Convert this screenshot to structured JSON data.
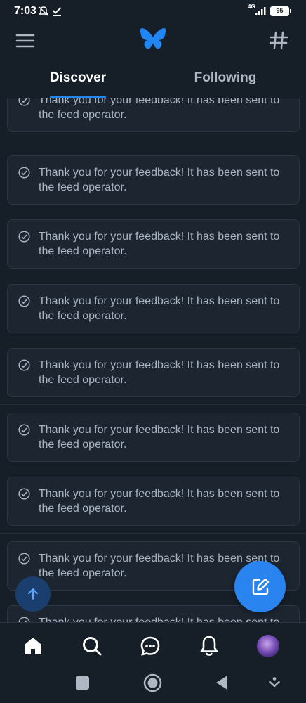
{
  "status_bar": {
    "time": "7:03",
    "network": "4G",
    "battery": "95"
  },
  "header": {
    "tabs": [
      {
        "label": "Discover",
        "active": true
      },
      {
        "label": "Following",
        "active": false
      }
    ],
    "accent_color": "#1f86f4"
  },
  "feed": {
    "items": [
      {
        "text": "Thank you for your feedback! It has been sent to the feed operator."
      },
      {
        "text": "Thank you for your feedback! It has been sent to the feed operator."
      },
      {
        "text": "Thank you for your feedback! It has been sent to the feed operator."
      },
      {
        "text": "Thank you for your feedback! It has been sent to the feed operator."
      },
      {
        "text": "Thank you for your feedback! It has been sent to the feed operator."
      },
      {
        "text": "Thank you for your feedback! It has been sent to the feed operator."
      },
      {
        "text": "Thank you for your feedback! It has been sent to the feed operator."
      },
      {
        "text": "Thank you for your feedback! It has been sent to the feed operator."
      },
      {
        "text": "Thank you for your feedback! It has been sent to the feed operator."
      }
    ]
  },
  "floating": {
    "scroll_top_icon": "arrow-up-icon",
    "compose_icon": "compose-icon",
    "compose_color": "#2a84f0"
  },
  "bottom_nav": {
    "items": [
      "home-icon",
      "search-icon",
      "chat-icon",
      "bell-icon",
      "avatar"
    ]
  },
  "system_nav": {
    "items": [
      "recents-icon",
      "home-circle-icon",
      "back-icon",
      "keyboard-hide-icon"
    ]
  }
}
